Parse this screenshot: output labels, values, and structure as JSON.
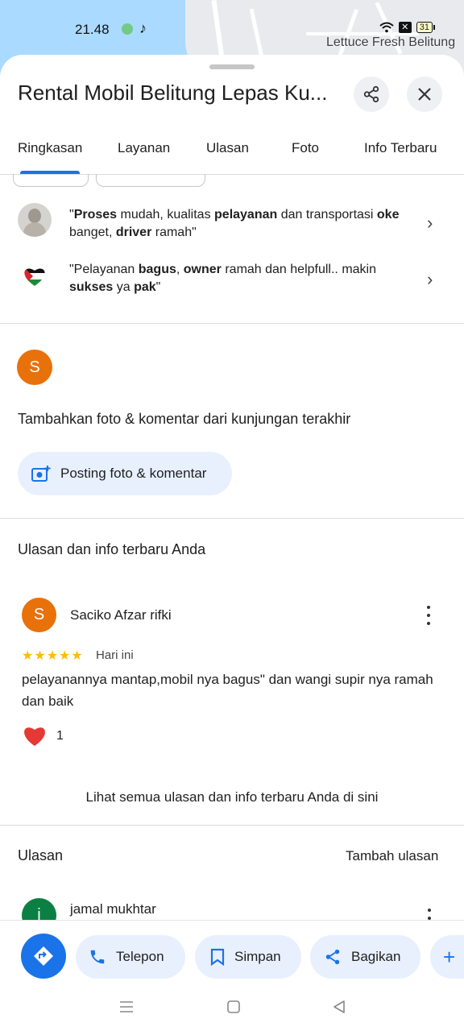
{
  "status_bar": {
    "time": "21.48",
    "battery": "31"
  },
  "map": {
    "place_label": "Lettuce Fresh Belitung"
  },
  "header": {
    "title": "Rental Mobil Belitung Lepas Ku..."
  },
  "tabs": [
    {
      "label": "Ringkasan",
      "active": true
    },
    {
      "label": "Layanan"
    },
    {
      "label": "Ulasan"
    },
    {
      "label": "Foto"
    },
    {
      "label": "Info Terbaru"
    }
  ],
  "review_snippets": [
    {
      "parts": [
        {
          "t": "\"",
          "b": false
        },
        {
          "t": "Proses",
          "b": true
        },
        {
          "t": " mudah, kualitas ",
          "b": false
        },
        {
          "t": "pelayanan",
          "b": true
        },
        {
          "t": " dan transportasi ",
          "b": false
        },
        {
          "t": "oke",
          "b": true
        },
        {
          "t": " banget, ",
          "b": false
        },
        {
          "t": "driver",
          "b": true
        },
        {
          "t": " ramah\"",
          "b": false
        }
      ]
    },
    {
      "parts": [
        {
          "t": "\"Pelayanan ",
          "b": false
        },
        {
          "t": "bagus",
          "b": true
        },
        {
          "t": ", ",
          "b": false
        },
        {
          "t": "owner",
          "b": true
        },
        {
          "t": " ramah dan helpfull.. makin ",
          "b": false
        },
        {
          "t": "sukses",
          "b": true
        },
        {
          "t": " ya ",
          "b": false
        },
        {
          "t": "pak",
          "b": true
        },
        {
          "t": "\"",
          "b": false
        }
      ]
    }
  ],
  "add_photo": {
    "avatar_letter": "S",
    "heading": "Tambahkan foto & komentar dari kunjungan terakhir",
    "button_label": "Posting foto & komentar"
  },
  "your_reviews": {
    "heading": "Ulasan dan info terbaru Anda",
    "review": {
      "avatar_letter": "S",
      "author": "Saciko Afzar rifki",
      "stars": "★★★★★",
      "rating": 5,
      "date": "Hari ini",
      "text": "pelayanannya mantap,mobil nya bagus\" dan wangi supir nya ramah dan baik",
      "likes": "1"
    },
    "see_all_link": "Lihat semua ulasan dan info terbaru Anda di sini"
  },
  "reviews": {
    "heading": "Ulasan",
    "add_review": "Tambah ulasan",
    "first": {
      "avatar_letter": "j",
      "author": "jamal mukhtar"
    }
  },
  "actions": [
    {
      "label": "Telepon"
    },
    {
      "label": "Simpan"
    },
    {
      "label": "Bagikan"
    }
  ],
  "colors": {
    "accent": "#1a73e8",
    "avatar_orange": "#e8710a",
    "pill_bg": "#e8f0fe",
    "star": "#fbbc04"
  }
}
